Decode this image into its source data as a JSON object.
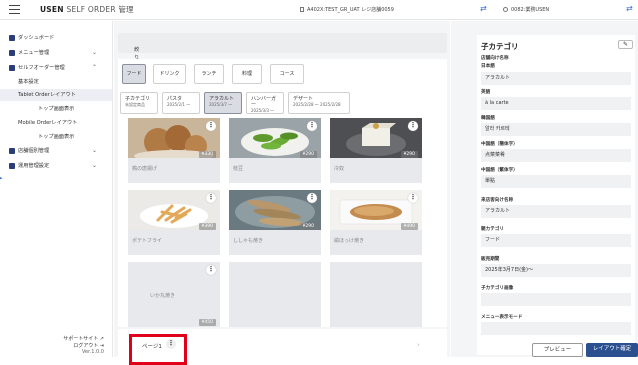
{
  "app": {
    "brand": "USEN",
    "title": "SELF ORDER 管理",
    "store": "A402X:TEST_GR_UAT レジ店舗0059",
    "account": "0082:業務USEN"
  },
  "sidebar": {
    "items": [
      {
        "label": "ダッシュボード",
        "chevron": ""
      },
      {
        "label": "メニュー管理",
        "chevron": "⌄"
      },
      {
        "label": "セルフオーダー管理",
        "chevron": "⌃"
      },
      {
        "label": "基本設定",
        "chevron": ""
      },
      {
        "label": "Tablet Orderレイアウト",
        "chevron": ""
      },
      {
        "label": "トップ画面表示",
        "chevron": ""
      },
      {
        "label": "Mobile Orderレイアウト",
        "chevron": ""
      },
      {
        "label": "トップ画面表示",
        "chevron": ""
      },
      {
        "label": "店舗個別管理",
        "chevron": "⌄"
      },
      {
        "label": "運用管理設定",
        "chevron": "⌄"
      }
    ],
    "footer": {
      "support": "サポートサイト",
      "logout": "ログアウト",
      "version": "Ver.1.0.0"
    }
  },
  "filter": {
    "label": "絞り込み検索"
  },
  "categories": [
    "フード",
    "ドリンク",
    "ランチ",
    "料理",
    "コース"
  ],
  "subtabs": [
    {
      "title": "子カテゴリ",
      "date": "未設定商品"
    },
    {
      "title": "パスタ",
      "date": "2025/2/1 〜"
    },
    {
      "title": "アラカルト",
      "date": "2025/3/7 〜"
    },
    {
      "title": "ハンバーガー",
      "date": "2025/3/3 〜"
    },
    {
      "title": "デザート",
      "date": "2025/2/28 〜 2025/2/28"
    }
  ],
  "menu_items": [
    {
      "name": "鶏の唐揚げ",
      "price": "¥330",
      "photo": "karaage"
    },
    {
      "name": "枝豆",
      "price": "¥290",
      "photo": "edamame"
    },
    {
      "name": "冷奴",
      "price": "¥290",
      "photo": "tofu"
    },
    {
      "name": "ポテトフライ",
      "price": "¥390",
      "photo": "fries"
    },
    {
      "name": "ししゃも焼き",
      "price": "¥290",
      "photo": "shishamo"
    },
    {
      "name": "縞ほっけ焼き",
      "price": "¥490",
      "photo": "hokke"
    },
    {
      "name": "いか丸焼き",
      "price": "¥450",
      "photo": ""
    }
  ],
  "pager": {
    "label": "ページ1",
    "more": "⋮"
  },
  "detail": {
    "title": "子カテゴリ",
    "edit_icon": "pencil-icon",
    "fields": [
      {
        "label": "店舗向け名称",
        "value": ""
      },
      {
        "label": "日本語",
        "value": "アラカルト"
      },
      {
        "label": "英語",
        "value": "à la carte"
      },
      {
        "label": "韓国語",
        "value": "알라 카르테"
      },
      {
        "label": "中国語（簡体字）",
        "value": "点菜菜肴"
      },
      {
        "label": "中国語（繁体字）",
        "value": "單點"
      },
      {
        "label": "来店客向け名称",
        "value": "アラカルト"
      },
      {
        "label": "親カテゴリ",
        "value": "フード"
      },
      {
        "label": "販売期間",
        "value": "2025年3月7日(金)〜"
      },
      {
        "label": "子カテゴリ画像",
        "value": ""
      },
      {
        "label": "メニュー表示モード",
        "value": ""
      }
    ]
  },
  "actions": {
    "preview": "プレビュー",
    "confirm": "レイアウト確定"
  },
  "colors": {
    "accent": "#2b4f8f",
    "highlight": "#e0001a"
  }
}
